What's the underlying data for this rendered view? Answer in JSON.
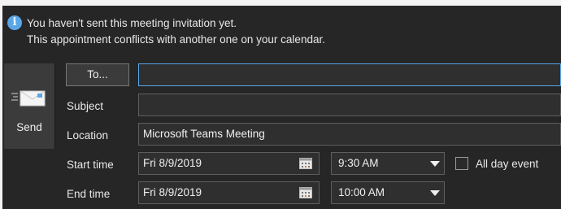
{
  "info_bar": {
    "icon": "info-icon",
    "line1": "You haven't sent this meeting invitation yet.",
    "line2": "This appointment conflicts with another one on your calendar."
  },
  "send": {
    "label": "Send",
    "icon": "envelope-icon"
  },
  "to": {
    "button_label": "To...",
    "value": ""
  },
  "subject": {
    "label": "Subject",
    "value": ""
  },
  "location": {
    "label": "Location",
    "value": "Microsoft Teams Meeting"
  },
  "start": {
    "label": "Start time",
    "date": "Fri 8/9/2019",
    "time": "9:30 AM"
  },
  "end": {
    "label": "End time",
    "date": "Fri 8/9/2019",
    "time": "10:00 AM"
  },
  "all_day": {
    "label": "All day event",
    "checked": false
  },
  "colors": {
    "panel": "#262626",
    "accent": "#5aa7e8",
    "field": "#2f2f2f"
  }
}
